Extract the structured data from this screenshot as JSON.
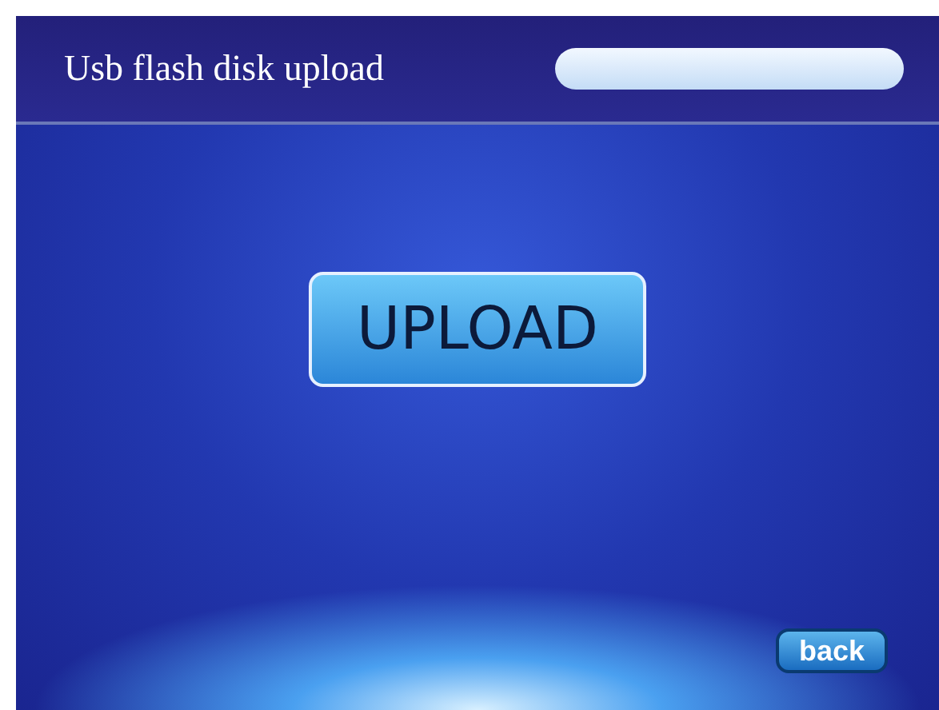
{
  "header": {
    "title": "Usb flash disk upload"
  },
  "upload_button": {
    "label": "UPLOAD"
  },
  "back_button": {
    "label": "back"
  }
}
